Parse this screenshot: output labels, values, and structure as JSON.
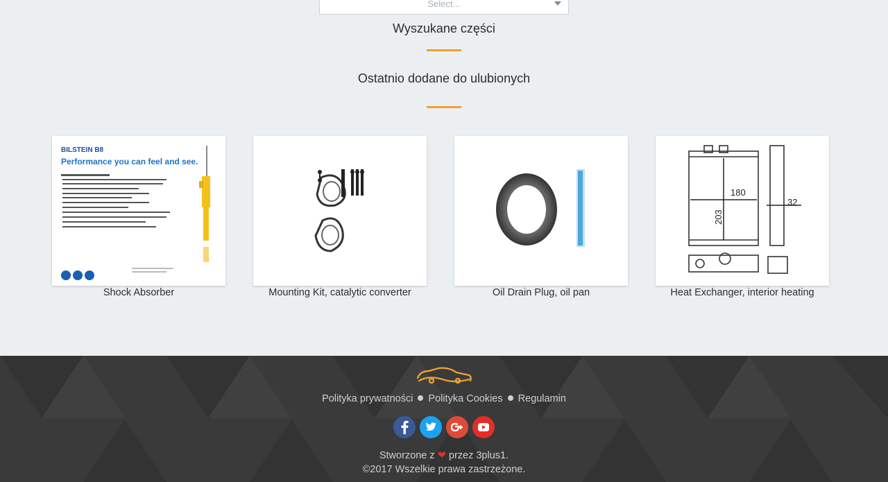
{
  "search": {
    "placeholder": "Select..."
  },
  "sections": {
    "searched_parts": "Wyszukane części",
    "recent_favorites": "Ostatnio dodane do ulubionych"
  },
  "products": [
    {
      "caption": "Shock Absorber",
      "image_text": {
        "brand": "BILSTEIN B8",
        "slogan": "Performance you can feel and see."
      }
    },
    {
      "caption": "Mounting Kit, catalytic converter"
    },
    {
      "caption": "Oil Drain Plug, oil pan"
    },
    {
      "caption": "Heat Exchanger, interior heating",
      "image_text": {
        "dim_width": "180",
        "dim_height": "203",
        "dim_depth": "32"
      }
    }
  ],
  "footer": {
    "logo_icon": "car-wrench-icon",
    "links": [
      "Polityka prywatności",
      "Polityka Cookies",
      "Regulamin"
    ],
    "social": [
      {
        "name": "facebook-icon",
        "color": "#3b5998"
      },
      {
        "name": "twitter-icon",
        "color": "#1da1f2"
      },
      {
        "name": "google-plus-icon",
        "color": "#dd4b39"
      },
      {
        "name": "youtube-icon",
        "color": "#e52d27"
      }
    ],
    "credit_prefix": "Stworzone z",
    "credit_suffix": "przez 3plus1.",
    "copyright": "©2017 Wszelkie prawa zastrzeżone."
  },
  "colors": {
    "accent": "#f0a030",
    "heart": "#e03030",
    "footer_bg": "#3a3a3a"
  }
}
